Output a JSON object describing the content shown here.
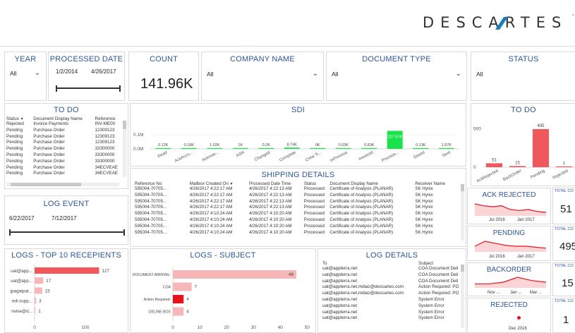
{
  "header": {
    "logo_text": "DESCARTES"
  },
  "year": {
    "title": "YEAR",
    "selected": "All"
  },
  "processed_date": {
    "title": "PROCESSED DATE",
    "start": "1/2/2014",
    "end": "4/26/2017"
  },
  "count": {
    "title": "COUNT",
    "value": "141.96K"
  },
  "company": {
    "title": "COMPANY NAME",
    "selected": "All"
  },
  "doctype": {
    "title": "DOCUMENT TYPE",
    "selected": "All"
  },
  "status": {
    "title": "STATUS",
    "selected": "All"
  },
  "todo_table": {
    "title": "TO DO",
    "headers": [
      "Status",
      "Document Display Name",
      "Reference"
    ],
    "rows": [
      [
        "Rejected",
        "Invoice Payments",
        "INV-ME00"
      ],
      [
        "Pending",
        "Purchase Order",
        "12309123"
      ],
      [
        "Pending",
        "Purchase Order",
        "12309123"
      ],
      [
        "Pending",
        "Purchase Order",
        "12309123"
      ],
      [
        "Pending",
        "Purchase Order",
        "33300000"
      ],
      [
        "Pending",
        "Purchase Order",
        "33300000"
      ],
      [
        "Pending",
        "Purchase Order",
        "33300000"
      ],
      [
        "Pending",
        "Purchase Order",
        "34ECVEAE"
      ],
      [
        "Pending",
        "Purchase Order",
        "34ECVEAE"
      ]
    ]
  },
  "sdi": {
    "title": "SDI",
    "yticks": [
      "0.1M",
      "0.0M"
    ],
    "labels": [
      "0.12K",
      "0.18K",
      "1.02K",
      "1K",
      "0.2K",
      "8.74K",
      "0K",
      "0.03K",
      "0.83K",
      "127.57K",
      "0.13K",
      "1.57K"
    ]
  },
  "todo_chart": {
    "title": "TO DO",
    "yticks": [
      "500",
      "0"
    ]
  },
  "log_event": {
    "title": "LOG EVENT",
    "start": "6/22/2017",
    "end": "7/12/2017"
  },
  "shipping": {
    "title": "SHIPPING DETAILS",
    "headers": [
      "Reference No",
      "Mailbox Created On",
      "Processed Date Time",
      "Status",
      "Document Display Name",
      "Receiver Name"
    ],
    "rows": [
      [
        "595004-70705...",
        "4/26/2017 4:22:17 AM",
        "4/26/2017 4:22:13 AM",
        "Processed",
        "Certificate of Analysis (PLANAR)",
        "SK Hynix"
      ],
      [
        "595004-70705...",
        "4/26/2017 4:22:17 AM",
        "4/26/2017 4:22:13 AM",
        "Processed",
        "Certificate of Analysis (PLANAR)",
        "SK Hynix"
      ],
      [
        "595004-70705...",
        "4/26/2017 4:22:17 AM",
        "4/26/2017 4:22:13 AM",
        "Processed",
        "Certificate of Analysis (PLANAR)",
        "SK Hynix"
      ],
      [
        "595004-70705...",
        "4/26/2017 4:22:17 AM",
        "4/26/2017 4:22:13 AM",
        "Processed",
        "Certificate of Analysis (PLANAR)",
        "SK Hynix"
      ],
      [
        "595004-70705...",
        "4/26/2017 4:10:24 AM",
        "4/26/2017 4:10:20 AM",
        "Processed",
        "Certificate of Analysis (PLANAR)",
        "SK Hynix"
      ],
      [
        "595004-70705...",
        "4/26/2017 4:10:24 AM",
        "4/26/2017 4:10:20 AM",
        "Processed",
        "Certificate of Analysis (PLANAR)",
        "SK Hynix"
      ],
      [
        "595004-70705...",
        "4/26/2017 4:10:24 AM",
        "4/26/2017 4:10:20 AM",
        "Processed",
        "Certificate of Analysis (PLANAR)",
        "SK Hynix"
      ],
      [
        "595004-70705...",
        "4/26/2017 4:10:24 AM",
        "4/26/2017 4:10:20 AM",
        "Processed",
        "Certificate of Analysis (PLANAR)",
        "SK Hynix"
      ]
    ]
  },
  "ack_rejected": {
    "title": "ACK REJECTED",
    "x1": "Jul 2016",
    "x2": "Jan 2017",
    "total_label": "TOTAL CO",
    "total": "51"
  },
  "pending": {
    "title": "PENDING",
    "x1": "Jul 2016",
    "x2": "Jan 2017",
    "total_label": "TOTAL CO",
    "total": "495"
  },
  "backorder": {
    "title": "BACKORDER",
    "x1": "Nov ...",
    "x2": "Jan ...",
    "x3": "Mar ...",
    "total_label": "TOTAL CO",
    "total": "15"
  },
  "rejected": {
    "title": "REJECTED",
    "x1": "Dec 2016",
    "total_label": "TOTAL CO",
    "total": "1"
  },
  "logs_recipients": {
    "title": "LOGS - TOP 10 RECEPIENTS",
    "xticks": [
      "0",
      "100"
    ]
  },
  "logs_subject": {
    "title": "LOGS - SUBJECT",
    "xticks": [
      "0",
      "10",
      "20",
      "30",
      "40",
      "50"
    ]
  },
  "log_details": {
    "title": "LOG DETAILS",
    "headers": [
      "To",
      "Subject"
    ],
    "rows": [
      [
        "uat@appterra.net",
        "COA Document Deli"
      ],
      [
        "uat@appterra.net",
        "COA Document Deli"
      ],
      [
        "uat@appterra.net",
        "COA Document Deli"
      ],
      [
        "uat@appterra.net,mdiaz@descartes.com",
        "Action Required: PO"
      ],
      [
        "uat@appterra.net,mdiaz@descartes.com",
        "Action Required: PO"
      ],
      [
        "uat@appterra.net",
        "System Error"
      ],
      [
        "uat@appterra.net",
        "System Error"
      ],
      [
        "uat@appterra.net",
        "System Error"
      ],
      [
        "uat@appterra.net",
        "System Error"
      ]
    ]
  },
  "colors": {
    "accent": "#2b5797",
    "green": "#19e34a",
    "red": "#f0595b",
    "pink": "#f7b6b7",
    "brightred": "#e8121d"
  },
  "chart_data": [
    {
      "type": "bar",
      "title": "SDI",
      "categories": [
        "Read",
        "AckAccu...",
        "Acknow...",
        "ASN",
        "Changed",
        "Complete",
        "Crew Ti...",
        "InProcess",
        "Invoiced",
        "Process...",
        "Saved",
        "Sent"
      ],
      "values": [
        0.12,
        0.18,
        1.02,
        1,
        0.2,
        8.74,
        0,
        0.03,
        0.83,
        127.57,
        0.13,
        1.57
      ],
      "unit": "K",
      "ylim": [
        0,
        140
      ]
    },
    {
      "type": "bar",
      "title": "TO DO",
      "categories": [
        "AckRejected",
        "BackOrder",
        "Pending",
        "Rejected"
      ],
      "values": [
        51,
        15,
        495,
        1
      ],
      "ylim": [
        0,
        550
      ]
    },
    {
      "type": "bar",
      "orientation": "horizontal",
      "title": "LOGS - TOP 10 RECEPIENTS",
      "categories": [
        "uat@app...",
        "uat@app...",
        "jpagatpat...",
        "edi.supp...",
        "rwise@d..."
      ],
      "values": [
        127,
        17,
        15,
        3,
        1
      ],
      "xlim": [
        0,
        150
      ]
    },
    {
      "type": "bar",
      "orientation": "horizontal",
      "title": "LOGS - SUBJECT",
      "categories": [
        "DOCUMENT ARRIVAL:",
        "COA",
        "Action Required:",
        "DELINE BOX"
      ],
      "values": [
        46,
        7,
        4,
        4
      ],
      "xlim": [
        0,
        52
      ]
    },
    {
      "type": "line",
      "title": "ACK REJECTED",
      "values": [
        12,
        10,
        9,
        10,
        6,
        5,
        6,
        4,
        3
      ]
    },
    {
      "type": "line",
      "title": "PENDING",
      "values": [
        5,
        10,
        8,
        6,
        5,
        5,
        4,
        3
      ]
    },
    {
      "type": "line",
      "title": "BACKORDER",
      "values": [
        2,
        2,
        3,
        6,
        4,
        3
      ]
    }
  ]
}
